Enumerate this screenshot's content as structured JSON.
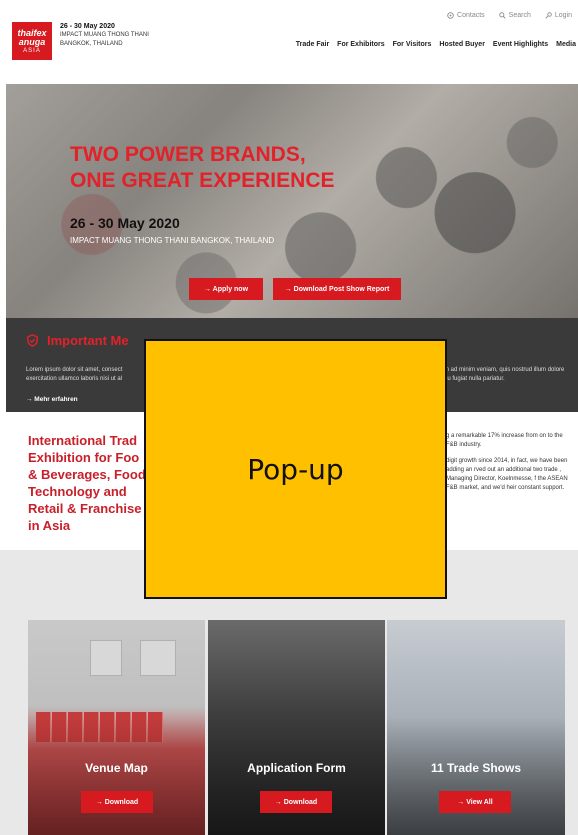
{
  "header": {
    "logo": {
      "line1": "thaifex",
      "line2": "anuga",
      "line3": "ASIA"
    },
    "date": "26 - 30 May 2020",
    "venue_line1": "IMPACT MUANG THONG THANI",
    "venue_line2": "BANGKOK, THAILAND",
    "utility": [
      {
        "icon": "contacts-icon",
        "label": "Contacts"
      },
      {
        "icon": "search-icon",
        "label": "Search"
      },
      {
        "icon": "key-icon",
        "label": "Login"
      }
    ],
    "nav": [
      "Trade Fair",
      "For Exhibitors",
      "For Visitors",
      "Hosted Buyer",
      "Event Highlights",
      "Media"
    ]
  },
  "hero": {
    "title_line1": "TWO POWER BRANDS,",
    "title_line2": "ONE GREAT EXPERIENCE",
    "date": "26 - 30 May 2020",
    "venue": "IMPACT MUANG THONG THANI BANGKOK, THAILAND",
    "apply_label": "→ Apply now",
    "report_label": "→ Download Post Show Report"
  },
  "message": {
    "title": "Important Me",
    "text_left": "Lorem ipsum dolor sit amet, consect exercitation ullamco laboris nisi ut al",
    "text_right": "m ad minim veniam, quis nostrud illum dolore eu fugiat nulla pariatur.",
    "more_label": "→ Mehr erfahren"
  },
  "intro": {
    "title": "International Trad Exhibition for Foo & Beverages, Food Technology and Retail & Franchise in Asia",
    "p1": "g a remarkable 17% increase from on to the F&B industry.",
    "p2": "digit growth since 2014, in fact, we have been adding an rved out an additional two trade , Managing Director, Koelnmesse, f the ASEAN F&B market, and we'd heir constant support."
  },
  "cards": [
    {
      "title": "Venue Map",
      "button": "→ Download"
    },
    {
      "title": "Application Form",
      "button": "→ Download"
    },
    {
      "title": "11 Trade Shows",
      "button": "→ View All"
    }
  ],
  "popup": {
    "label": "Pop-up"
  }
}
